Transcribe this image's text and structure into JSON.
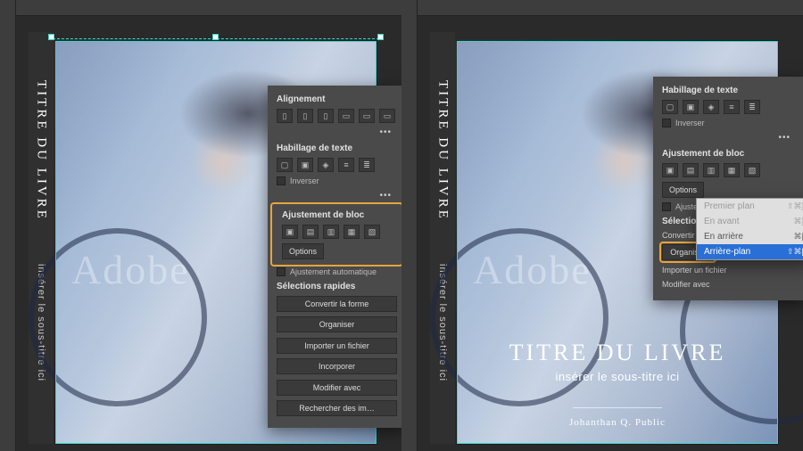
{
  "book": {
    "title": "TITRE DU LIVRE",
    "subtitle": "insérer le sous-titre ici",
    "author": "Johanthan Q. Public",
    "watermark": "Adobe"
  },
  "panel_left": {
    "section_align": "Alignement",
    "section_wrap": "Habillage de texte",
    "wrap_invert": "Inverser",
    "section_fit": "Ajustement de bloc",
    "fit_options": "Options",
    "fit_auto": "Ajustement automatique",
    "section_quick": "Sélections rapides",
    "convert": "Convertir la forme",
    "organize": "Organiser",
    "import": "Importer un fichier",
    "embed": "Incorporer",
    "modify": "Modifier avec",
    "search": "Rechercher des im…"
  },
  "panel_right": {
    "section_wrap": "Habillage de texte",
    "wrap_invert": "Inverser",
    "section_fit": "Ajustement de bloc",
    "fit_options": "Options",
    "fit_auto": "Ajustement automatique",
    "section_quick": "Sélections rapides",
    "convert_lbl": "Convertir la forme",
    "organize": "Organiser",
    "import_lbl": "Importer un fichier",
    "modify_lbl": "Modifier avec"
  },
  "menu": {
    "front": "Premier plan",
    "front_sc": "⇧⌘]",
    "forward": "En avant",
    "forward_sc": "⌘]",
    "backward": "En arrière",
    "backward_sc": "⌘[",
    "back": "Arrière-plan",
    "back_sc": "⇧⌘["
  }
}
